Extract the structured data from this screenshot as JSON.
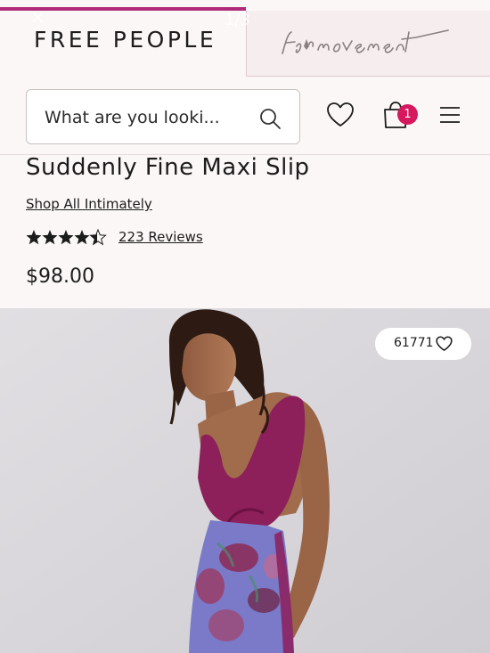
{
  "brand_tabs": {
    "active_brand": "FREE PEOPLE",
    "inactive_brand": "fp movement",
    "ghost_counter": "1/3"
  },
  "header": {
    "search_placeholder": "What are you looki...",
    "cart_count": "1"
  },
  "product": {
    "title": "Suddenly Fine Maxi Slip",
    "collection_link": "Shop All Intimately",
    "rating": 4.5,
    "rating_max": 5,
    "reviews_label": "223 Reviews",
    "price": "$98.00",
    "favorites_count": "61771"
  },
  "colors": {
    "accent": "#b02a7a",
    "badge": "#d6185e",
    "garment_top": "#8d1f5a",
    "garment_skirt": "#7a7ac9"
  },
  "icons": [
    "search-icon",
    "heart-icon",
    "bag-icon",
    "menu-icon",
    "star-icon",
    "favorite-heart-icon"
  ]
}
